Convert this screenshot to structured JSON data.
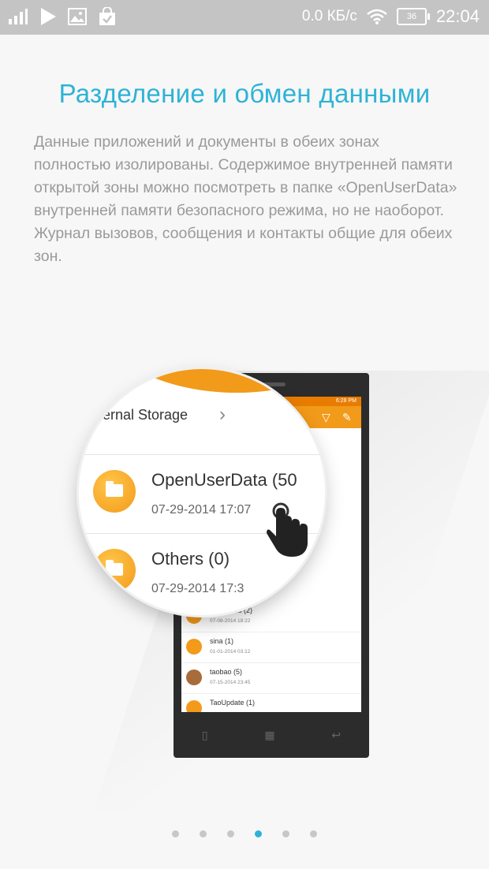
{
  "status_bar": {
    "speed": "0.0 КБ/с",
    "battery": "36",
    "time": "22:04",
    "icons": [
      "signal-icon",
      "play-icon",
      "image-icon",
      "shopping-bag-icon",
      "wifi-icon",
      "battery-icon"
    ]
  },
  "title": "Разделение и обмен данными",
  "description": "Данные приложений и документы в обеих зонах полностью изолированы. Содержимое внутренней памяти открытой зоны можно посмотреть в папке «OpenUserData» внутренней памяти безопасного режима, но не наоборот. Журнал вызовов, сообщения и контакты общие для обеих зон.",
  "illustration": {
    "screen_time": "6:28 PM",
    "magnifier": {
      "path": "ernal Storage",
      "items": [
        {
          "name": "OpenUserData (50",
          "date": "07-29-2014 17:07"
        },
        {
          "name": "Others (0)",
          "date": "07-29-2014 17:3"
        }
      ]
    },
    "list": [
      {
        "name": "Ringtones (2)",
        "date": "07-08-2014 18:22",
        "icon": "folder-icon"
      },
      {
        "name": "sina (1)",
        "date": "01-01-2014 03:12",
        "icon": "folder-icon"
      },
      {
        "name": "taobao (5)",
        "date": "07-15-2014 23:45",
        "icon": "taobao-app-icon"
      },
      {
        "name": "TaoUpdate (1)",
        "date": "",
        "icon": "folder-icon"
      }
    ]
  },
  "pagination": {
    "count": 6,
    "active_index": 3
  },
  "colors": {
    "accent": "#2eb3d6",
    "orange": "#f29a1a",
    "status_bar": "#c4c4c4"
  }
}
